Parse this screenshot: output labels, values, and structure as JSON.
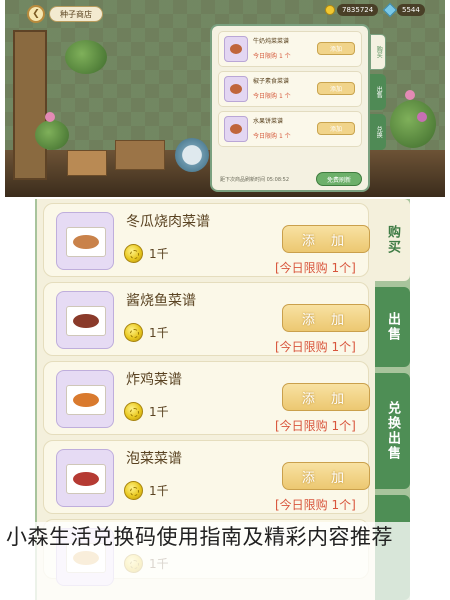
{
  "top_screenshot": {
    "shop_title": "种子商店",
    "currency": [
      {
        "icon": "coin-icon",
        "value": "7835724"
      },
      {
        "icon": "gem-icon",
        "value": "5544"
      }
    ],
    "items": [
      {
        "name": "牛奶炖菜菜谱",
        "limit": "今日限购",
        "count": "1 个",
        "add_label": "添加"
      },
      {
        "name": "椒子素食菜谱",
        "limit": "今日限购",
        "count": "1 个",
        "add_label": "添加"
      },
      {
        "name": "水果饼菜谱",
        "limit": "今日限购",
        "count": "1 个",
        "add_label": "添加"
      }
    ],
    "footer_text": "距下次商品刷新时间 05:08:52",
    "refresh_label": "免费刷新",
    "tabs": [
      "购买",
      "出售",
      "兑换"
    ]
  },
  "shop": {
    "add_label": "添 加",
    "items": [
      {
        "name": "冬瓜烧肉菜谱",
        "price": "1千",
        "limit": "[今日限购 1个]",
        "food_color": "#c9824a"
      },
      {
        "name": "酱烧鱼菜谱",
        "price": "1千",
        "limit": "[今日限购 1个]",
        "food_color": "#8a3a2a"
      },
      {
        "name": "炸鸡菜谱",
        "price": "1千",
        "limit": "[今日限购 1个]",
        "food_color": "#d97a2e"
      },
      {
        "name": "泡菜菜谱",
        "price": "1千",
        "limit": "[今日限购 1个]",
        "food_color": "#b53a33"
      },
      {
        "name": "",
        "price": "1千",
        "limit": "",
        "food_color": "#e3b35a"
      }
    ],
    "tabs": [
      "购买",
      "出售",
      "兑换出售"
    ]
  },
  "caption": "小森生活兑换码使用指南及精彩内容推荐",
  "colors": {
    "accent_green": "#4e8e55",
    "limit_red": "#d8553c",
    "button_gold": "#ecc871",
    "panel_cream": "#f4f0dc"
  }
}
